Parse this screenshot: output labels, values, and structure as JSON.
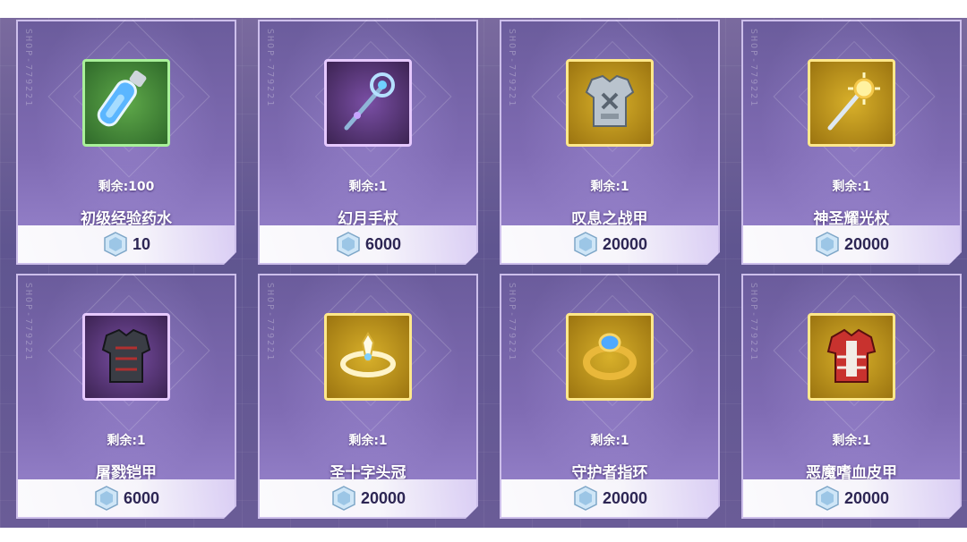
{
  "shop_code": "SHOP-779221",
  "currency_icon": "crystal-coin-icon",
  "items": [
    {
      "remaining": "剩余:100",
      "name": "初级经验药水",
      "price": "10",
      "icon": "potion-icon",
      "frame": "green"
    },
    {
      "remaining": "剩余:1",
      "name": "幻月手杖",
      "price": "6000",
      "icon": "moon-staff-icon",
      "frame": "purple"
    },
    {
      "remaining": "剩余:1",
      "name": "叹息之战甲",
      "price": "20000",
      "icon": "silver-armor-icon",
      "frame": "gold"
    },
    {
      "remaining": "剩余:1",
      "name": "神圣耀光杖",
      "price": "20000",
      "icon": "sun-staff-icon",
      "frame": "gold"
    },
    {
      "remaining": "剩余:1",
      "name": "屠戮铠甲",
      "price": "6000",
      "icon": "dark-armor-icon",
      "frame": "purple"
    },
    {
      "remaining": "剩余:1",
      "name": "圣十字头冠",
      "price": "20000",
      "icon": "crown-icon",
      "frame": "gold"
    },
    {
      "remaining": "剩余:1",
      "name": "守护者指环",
      "price": "20000",
      "icon": "ring-icon",
      "frame": "gold"
    },
    {
      "remaining": "剩余:1",
      "name": "恶魔嗜血皮甲",
      "price": "20000",
      "icon": "red-leather-armor-icon",
      "frame": "gold"
    }
  ]
}
